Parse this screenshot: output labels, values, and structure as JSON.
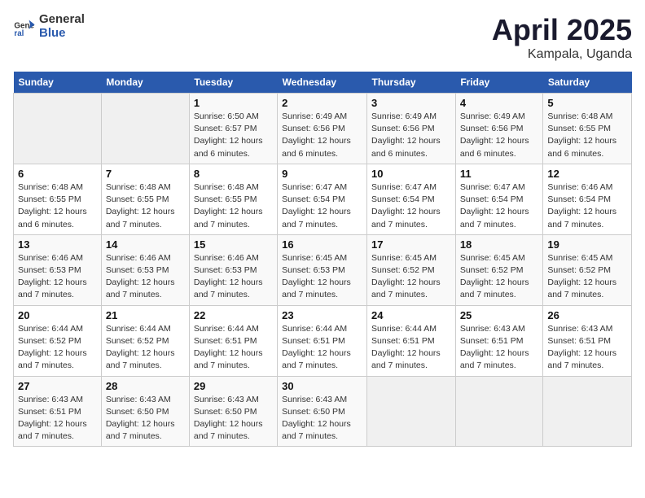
{
  "header": {
    "logo_general": "General",
    "logo_blue": "Blue",
    "month": "April 2025",
    "location": "Kampala, Uganda"
  },
  "weekdays": [
    "Sunday",
    "Monday",
    "Tuesday",
    "Wednesday",
    "Thursday",
    "Friday",
    "Saturday"
  ],
  "weeks": [
    [
      {
        "day": "",
        "detail": ""
      },
      {
        "day": "",
        "detail": ""
      },
      {
        "day": "1",
        "detail": "Sunrise: 6:50 AM\nSunset: 6:57 PM\nDaylight: 12 hours and 6 minutes."
      },
      {
        "day": "2",
        "detail": "Sunrise: 6:49 AM\nSunset: 6:56 PM\nDaylight: 12 hours and 6 minutes."
      },
      {
        "day": "3",
        "detail": "Sunrise: 6:49 AM\nSunset: 6:56 PM\nDaylight: 12 hours and 6 minutes."
      },
      {
        "day": "4",
        "detail": "Sunrise: 6:49 AM\nSunset: 6:56 PM\nDaylight: 12 hours and 6 minutes."
      },
      {
        "day": "5",
        "detail": "Sunrise: 6:48 AM\nSunset: 6:55 PM\nDaylight: 12 hours and 6 minutes."
      }
    ],
    [
      {
        "day": "6",
        "detail": "Sunrise: 6:48 AM\nSunset: 6:55 PM\nDaylight: 12 hours and 6 minutes."
      },
      {
        "day": "7",
        "detail": "Sunrise: 6:48 AM\nSunset: 6:55 PM\nDaylight: 12 hours and 7 minutes."
      },
      {
        "day": "8",
        "detail": "Sunrise: 6:48 AM\nSunset: 6:55 PM\nDaylight: 12 hours and 7 minutes."
      },
      {
        "day": "9",
        "detail": "Sunrise: 6:47 AM\nSunset: 6:54 PM\nDaylight: 12 hours and 7 minutes."
      },
      {
        "day": "10",
        "detail": "Sunrise: 6:47 AM\nSunset: 6:54 PM\nDaylight: 12 hours and 7 minutes."
      },
      {
        "day": "11",
        "detail": "Sunrise: 6:47 AM\nSunset: 6:54 PM\nDaylight: 12 hours and 7 minutes."
      },
      {
        "day": "12",
        "detail": "Sunrise: 6:46 AM\nSunset: 6:54 PM\nDaylight: 12 hours and 7 minutes."
      }
    ],
    [
      {
        "day": "13",
        "detail": "Sunrise: 6:46 AM\nSunset: 6:53 PM\nDaylight: 12 hours and 7 minutes."
      },
      {
        "day": "14",
        "detail": "Sunrise: 6:46 AM\nSunset: 6:53 PM\nDaylight: 12 hours and 7 minutes."
      },
      {
        "day": "15",
        "detail": "Sunrise: 6:46 AM\nSunset: 6:53 PM\nDaylight: 12 hours and 7 minutes."
      },
      {
        "day": "16",
        "detail": "Sunrise: 6:45 AM\nSunset: 6:53 PM\nDaylight: 12 hours and 7 minutes."
      },
      {
        "day": "17",
        "detail": "Sunrise: 6:45 AM\nSunset: 6:52 PM\nDaylight: 12 hours and 7 minutes."
      },
      {
        "day": "18",
        "detail": "Sunrise: 6:45 AM\nSunset: 6:52 PM\nDaylight: 12 hours and 7 minutes."
      },
      {
        "day": "19",
        "detail": "Sunrise: 6:45 AM\nSunset: 6:52 PM\nDaylight: 12 hours and 7 minutes."
      }
    ],
    [
      {
        "day": "20",
        "detail": "Sunrise: 6:44 AM\nSunset: 6:52 PM\nDaylight: 12 hours and 7 minutes."
      },
      {
        "day": "21",
        "detail": "Sunrise: 6:44 AM\nSunset: 6:52 PM\nDaylight: 12 hours and 7 minutes."
      },
      {
        "day": "22",
        "detail": "Sunrise: 6:44 AM\nSunset: 6:51 PM\nDaylight: 12 hours and 7 minutes."
      },
      {
        "day": "23",
        "detail": "Sunrise: 6:44 AM\nSunset: 6:51 PM\nDaylight: 12 hours and 7 minutes."
      },
      {
        "day": "24",
        "detail": "Sunrise: 6:44 AM\nSunset: 6:51 PM\nDaylight: 12 hours and 7 minutes."
      },
      {
        "day": "25",
        "detail": "Sunrise: 6:43 AM\nSunset: 6:51 PM\nDaylight: 12 hours and 7 minutes."
      },
      {
        "day": "26",
        "detail": "Sunrise: 6:43 AM\nSunset: 6:51 PM\nDaylight: 12 hours and 7 minutes."
      }
    ],
    [
      {
        "day": "27",
        "detail": "Sunrise: 6:43 AM\nSunset: 6:51 PM\nDaylight: 12 hours and 7 minutes."
      },
      {
        "day": "28",
        "detail": "Sunrise: 6:43 AM\nSunset: 6:50 PM\nDaylight: 12 hours and 7 minutes."
      },
      {
        "day": "29",
        "detail": "Sunrise: 6:43 AM\nSunset: 6:50 PM\nDaylight: 12 hours and 7 minutes."
      },
      {
        "day": "30",
        "detail": "Sunrise: 6:43 AM\nSunset: 6:50 PM\nDaylight: 12 hours and 7 minutes."
      },
      {
        "day": "",
        "detail": ""
      },
      {
        "day": "",
        "detail": ""
      },
      {
        "day": "",
        "detail": ""
      }
    ]
  ]
}
